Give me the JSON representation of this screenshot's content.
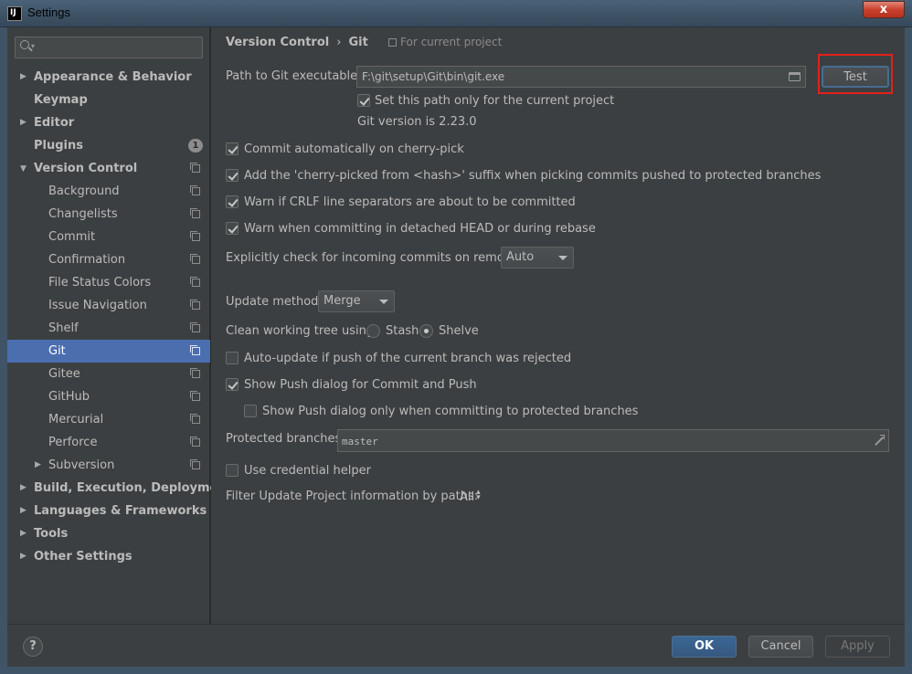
{
  "window": {
    "title": "Settings",
    "app_icon_text": "IJ",
    "close_glyph": "x"
  },
  "sidebar": {
    "search_placeholder": "",
    "items": [
      {
        "label": "Appearance & Behavior",
        "level": 0,
        "bold": true,
        "arrow": "right",
        "project_icon": false
      },
      {
        "label": "Keymap",
        "level": 0,
        "bold": true,
        "arrow": null,
        "project_icon": false
      },
      {
        "label": "Editor",
        "level": 0,
        "bold": true,
        "arrow": "right",
        "project_icon": false
      },
      {
        "label": "Plugins",
        "level": 0,
        "bold": true,
        "arrow": null,
        "badge": "1",
        "project_icon": false
      },
      {
        "label": "Version Control",
        "level": 0,
        "bold": true,
        "arrow": "down",
        "project_icon": true
      },
      {
        "label": "Background",
        "level": 1,
        "project_icon": true
      },
      {
        "label": "Changelists",
        "level": 1,
        "project_icon": true
      },
      {
        "label": "Commit",
        "level": 1,
        "project_icon": true
      },
      {
        "label": "Confirmation",
        "level": 1,
        "project_icon": true
      },
      {
        "label": "File Status Colors",
        "level": 1,
        "project_icon": true
      },
      {
        "label": "Issue Navigation",
        "level": 1,
        "project_icon": true
      },
      {
        "label": "Shelf",
        "level": 1,
        "project_icon": true
      },
      {
        "label": "Git",
        "level": 1,
        "project_icon": true,
        "selected": true
      },
      {
        "label": "Gitee",
        "level": 1,
        "project_icon": true
      },
      {
        "label": "GitHub",
        "level": 1,
        "project_icon": true
      },
      {
        "label": "Mercurial",
        "level": 1,
        "project_icon": true
      },
      {
        "label": "Perforce",
        "level": 1,
        "project_icon": true
      },
      {
        "label": "Subversion",
        "level": 1,
        "arrow": "right",
        "project_icon": true
      },
      {
        "label": "Build, Execution, Deployment",
        "level": 0,
        "bold": true,
        "arrow": "right",
        "project_icon": false
      },
      {
        "label": "Languages & Frameworks",
        "level": 0,
        "bold": true,
        "arrow": "right",
        "project_icon": false
      },
      {
        "label": "Tools",
        "level": 0,
        "bold": true,
        "arrow": "right",
        "project_icon": false
      },
      {
        "label": "Other Settings",
        "level": 0,
        "bold": true,
        "arrow": "right",
        "project_icon": false
      }
    ]
  },
  "breadcrumb": {
    "parent": "Version Control",
    "separator": "›",
    "current": "Git",
    "scope": "For current project"
  },
  "git": {
    "path_label": "Path to Git executable:",
    "path_value": "F:\\git\\setup\\Git\\bin\\git.exe",
    "test_button": "Test",
    "current_project_only": {
      "label": "Set this path only for the current project",
      "checked": true
    },
    "version_text": "Git version is 2.23.0",
    "options": [
      {
        "label": "Commit automatically on cherry-pick",
        "checked": true
      },
      {
        "label": "Add the 'cherry-picked from <hash>' suffix when picking commits pushed to protected branches",
        "checked": true
      },
      {
        "label": "Warn if CRLF line separators are about to be committed",
        "checked": true
      },
      {
        "label": "Warn when committing in detached HEAD or during rebase",
        "checked": true
      }
    ],
    "incoming_label": "Explicitly check for incoming commits on remotes:",
    "incoming_value": "Auto",
    "update_method_label": "Update method:",
    "update_method_value": "Merge",
    "clean_tree_label": "Clean working tree using:",
    "clean_tree_options": [
      {
        "label": "Stash",
        "selected": false
      },
      {
        "label": "Shelve",
        "selected": true
      }
    ],
    "auto_update": {
      "label": "Auto-update if push of the current branch was rejected",
      "checked": false
    },
    "show_push_dialog": {
      "label": "Show Push dialog for Commit and Push",
      "checked": true
    },
    "show_push_protected": {
      "label": "Show Push dialog only when committing to protected branches",
      "checked": false
    },
    "protected_label": "Protected branches:",
    "protected_value": "master",
    "credential_helper": {
      "label": "Use credential helper",
      "checked": false
    },
    "filter_label": "Filter Update Project information by paths:",
    "filter_value": "All"
  },
  "footer": {
    "help": "?",
    "ok": "OK",
    "cancel": "Cancel",
    "apply": "Apply"
  },
  "colors": {
    "accent_selection": "#4b6eaf",
    "highlight_box": "#e3201b",
    "panel_bg": "#3c3f41"
  }
}
